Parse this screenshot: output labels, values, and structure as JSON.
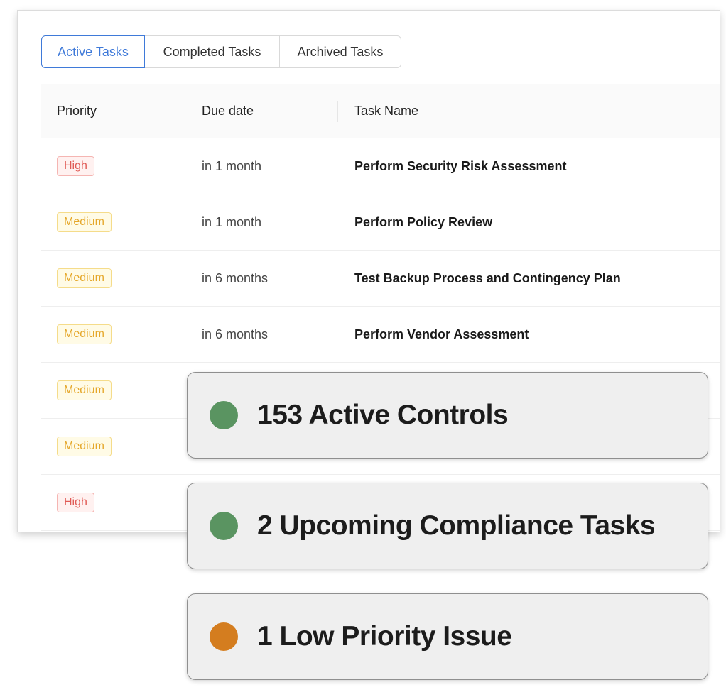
{
  "tabs": [
    {
      "label": "Active Tasks",
      "active": true
    },
    {
      "label": "Completed Tasks",
      "active": false
    },
    {
      "label": "Archived Tasks",
      "active": false
    }
  ],
  "table": {
    "headers": {
      "priority": "Priority",
      "due": "Due date",
      "name": "Task Name"
    },
    "rows": [
      {
        "priority": "High",
        "level": "high",
        "due": "in 1 month",
        "name": "Perform Security Risk Assessment"
      },
      {
        "priority": "Medium",
        "level": "medium",
        "due": "in 1 month",
        "name": "Perform Policy Review"
      },
      {
        "priority": "Medium",
        "level": "medium",
        "due": "in 6 months",
        "name": "Test Backup Process and Contingency Plan"
      },
      {
        "priority": "Medium",
        "level": "medium",
        "due": "in 6 months",
        "name": "Perform Vendor Assessment"
      },
      {
        "priority": "Medium",
        "level": "medium",
        "due": "",
        "name": ""
      },
      {
        "priority": "Medium",
        "level": "medium",
        "due": "",
        "name": ""
      },
      {
        "priority": "High",
        "level": "high",
        "due": "",
        "name": ""
      }
    ]
  },
  "cards": [
    {
      "text": "153 Active Controls",
      "status_color": "#5a9461"
    },
    {
      "text": "2 Upcoming Compliance Tasks",
      "status_color": "#5a9461"
    },
    {
      "text": "1 Low Priority Issue",
      "status_color": "#d47d1f"
    }
  ],
  "colors": {
    "accent": "#3f7ad9",
    "high": "#e05a55",
    "medium": "#e5a72a"
  }
}
